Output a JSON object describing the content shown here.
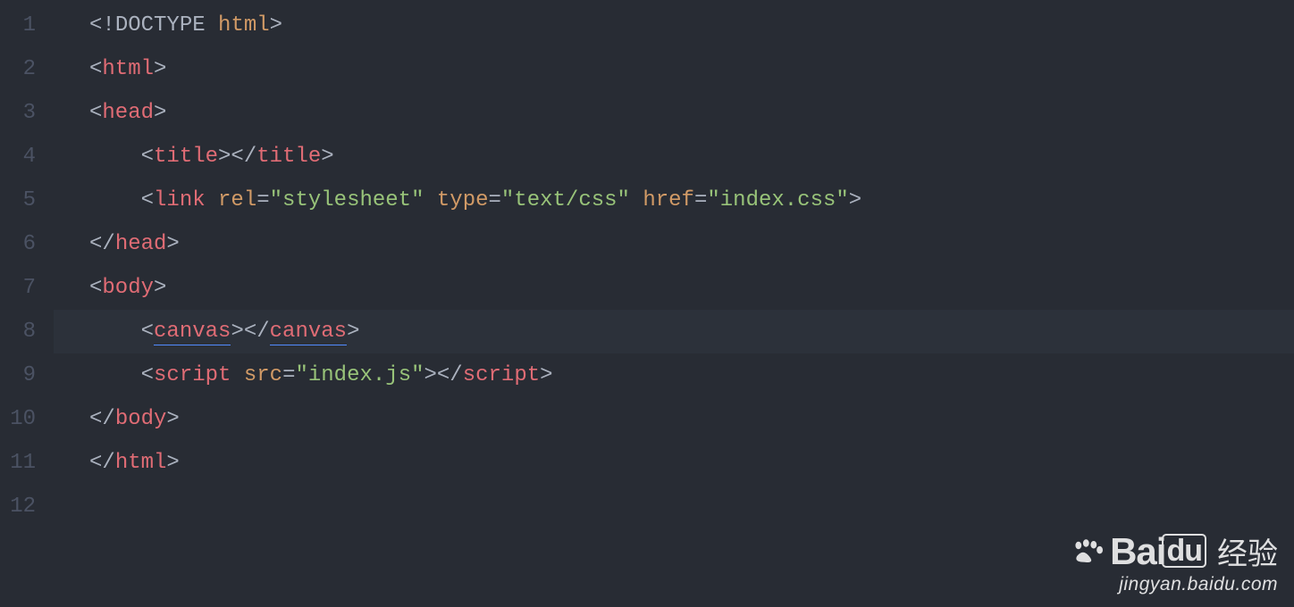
{
  "editor": {
    "highlighted_line": 8,
    "lines": [
      {
        "num": "1",
        "indent": 0,
        "tokens": [
          {
            "cls": "punct",
            "t": "<!"
          },
          {
            "cls": "doct",
            "t": "DOCTYPE"
          },
          {
            "cls": "punct",
            "t": " "
          },
          {
            "cls": "attr",
            "t": "html"
          },
          {
            "cls": "punct",
            "t": ">"
          }
        ]
      },
      {
        "num": "2",
        "indent": 0,
        "tokens": [
          {
            "cls": "punct",
            "t": "<"
          },
          {
            "cls": "tag",
            "t": "html"
          },
          {
            "cls": "punct",
            "t": ">"
          }
        ]
      },
      {
        "num": "3",
        "indent": 0,
        "tokens": [
          {
            "cls": "punct",
            "t": "<"
          },
          {
            "cls": "tag",
            "t": "head"
          },
          {
            "cls": "punct",
            "t": ">"
          }
        ]
      },
      {
        "num": "4",
        "indent": 1,
        "tokens": [
          {
            "cls": "punct",
            "t": "<"
          },
          {
            "cls": "tag",
            "t": "title"
          },
          {
            "cls": "punct",
            "t": "></"
          },
          {
            "cls": "tag",
            "t": "title"
          },
          {
            "cls": "punct",
            "t": ">"
          }
        ]
      },
      {
        "num": "5",
        "indent": 1,
        "tokens": [
          {
            "cls": "punct",
            "t": "<"
          },
          {
            "cls": "tag",
            "t": "link"
          },
          {
            "cls": "punct",
            "t": " "
          },
          {
            "cls": "attr",
            "t": "rel"
          },
          {
            "cls": "eq",
            "t": "="
          },
          {
            "cls": "str",
            "t": "\"stylesheet\""
          },
          {
            "cls": "punct",
            "t": " "
          },
          {
            "cls": "attr",
            "t": "type"
          },
          {
            "cls": "eq",
            "t": "="
          },
          {
            "cls": "str",
            "t": "\"text/css\""
          },
          {
            "cls": "punct",
            "t": " "
          },
          {
            "cls": "attr",
            "t": "href"
          },
          {
            "cls": "eq",
            "t": "="
          },
          {
            "cls": "str",
            "t": "\"index.css\""
          },
          {
            "cls": "punct",
            "t": ">"
          }
        ]
      },
      {
        "num": "6",
        "indent": 0,
        "tokens": [
          {
            "cls": "punct",
            "t": "</"
          },
          {
            "cls": "tag",
            "t": "head"
          },
          {
            "cls": "punct",
            "t": ">"
          }
        ]
      },
      {
        "num": "7",
        "indent": 0,
        "tokens": [
          {
            "cls": "punct",
            "t": "<"
          },
          {
            "cls": "tag",
            "t": "body"
          },
          {
            "cls": "punct",
            "t": ">"
          }
        ]
      },
      {
        "num": "8",
        "indent": 1,
        "tokens": [
          {
            "cls": "punct",
            "t": "<"
          },
          {
            "cls": "tag",
            "t": "canvas",
            "u": true
          },
          {
            "cls": "punct",
            "t": "></"
          },
          {
            "cls": "tag",
            "t": "canvas",
            "u": true
          },
          {
            "cls": "punct",
            "t": ">"
          }
        ]
      },
      {
        "num": "9",
        "indent": 1,
        "tokens": [
          {
            "cls": "punct",
            "t": "<"
          },
          {
            "cls": "tag",
            "t": "script"
          },
          {
            "cls": "punct",
            "t": " "
          },
          {
            "cls": "attr",
            "t": "src"
          },
          {
            "cls": "eq",
            "t": "="
          },
          {
            "cls": "str",
            "t": "\"index.js\""
          },
          {
            "cls": "punct",
            "t": "></"
          },
          {
            "cls": "tag",
            "t": "script"
          },
          {
            "cls": "punct",
            "t": ">"
          }
        ]
      },
      {
        "num": "10",
        "indent": 0,
        "tokens": [
          {
            "cls": "punct",
            "t": "</"
          },
          {
            "cls": "tag",
            "t": "body"
          },
          {
            "cls": "punct",
            "t": ">"
          }
        ]
      },
      {
        "num": "11",
        "indent": 0,
        "tokens": [
          {
            "cls": "punct",
            "t": "</"
          },
          {
            "cls": "tag",
            "t": "html"
          },
          {
            "cls": "punct",
            "t": ">"
          }
        ]
      },
      {
        "num": "12",
        "indent": 0,
        "tokens": []
      }
    ]
  },
  "watermark": {
    "brand_bai": "Bai",
    "brand_du": "du",
    "brand_cn": "经验",
    "url": "jingyan.baidu.com"
  }
}
